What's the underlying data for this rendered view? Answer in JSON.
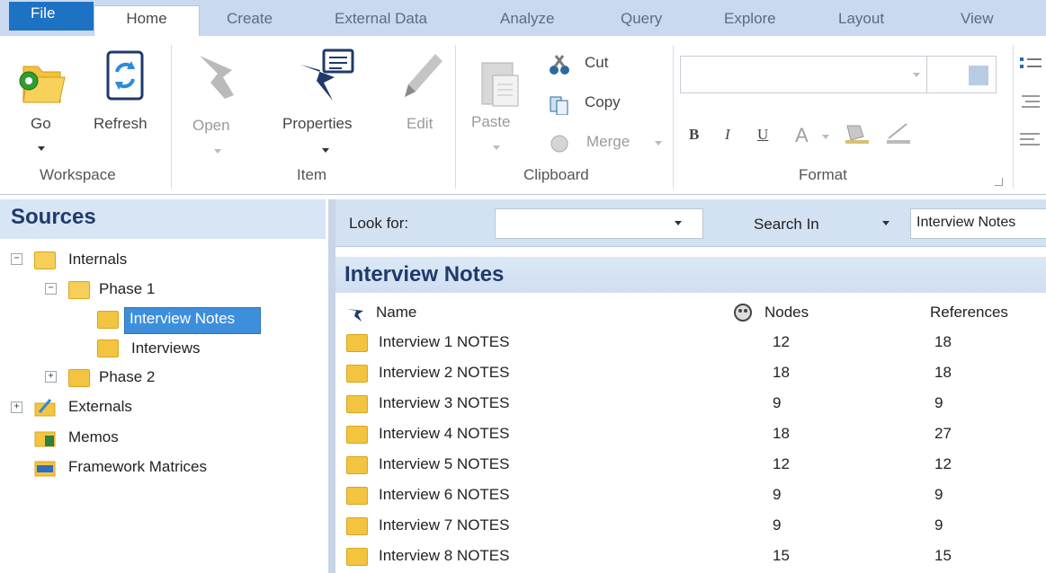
{
  "ribbon": {
    "tabs": [
      "File",
      "Home",
      "Create",
      "External Data",
      "Analyze",
      "Query",
      "Explore",
      "Layout",
      "View"
    ],
    "active_tab": "Home",
    "groups": {
      "workspace": {
        "label": "Workspace",
        "go": "Go",
        "refresh": "Refresh"
      },
      "item": {
        "label": "Item",
        "open": "Open",
        "properties": "Properties",
        "edit": "Edit"
      },
      "clipboard": {
        "label": "Clipboard",
        "paste": "Paste",
        "cut": "Cut",
        "copy": "Copy",
        "merge": "Merge"
      },
      "format": {
        "label": "Format",
        "bold": "B",
        "italic": "I",
        "underline": "U",
        "font_color": "A"
      }
    }
  },
  "sources": {
    "title": "Sources",
    "tree": {
      "internals": "Internals",
      "phase1": "Phase 1",
      "interview_notes": "Interview Notes",
      "interviews": "Interviews",
      "phase2": "Phase 2",
      "externals": "Externals",
      "memos": "Memos",
      "framework_matrices": "Framework Matrices"
    }
  },
  "search": {
    "look_for_label": "Look for:",
    "search_in_label": "Search In",
    "search_in_value": "Interview Notes"
  },
  "list": {
    "title": "Interview Notes",
    "columns": {
      "name": "Name",
      "nodes": "Nodes",
      "references": "References"
    },
    "rows": [
      {
        "name": "Interview 1 NOTES",
        "nodes": "12",
        "references": "18"
      },
      {
        "name": "Interview 2 NOTES",
        "nodes": "18",
        "references": "18"
      },
      {
        "name": "Interview 3 NOTES",
        "nodes": "9",
        "references": "9"
      },
      {
        "name": "Interview 4 NOTES",
        "nodes": "18",
        "references": "27"
      },
      {
        "name": "Interview 5 NOTES",
        "nodes": "12",
        "references": "12"
      },
      {
        "name": "Interview 6 NOTES",
        "nodes": "9",
        "references": "9"
      },
      {
        "name": "Interview 7 NOTES",
        "nodes": "9",
        "references": "9"
      },
      {
        "name": "Interview 8 NOTES",
        "nodes": "15",
        "references": "15"
      }
    ]
  },
  "colors": {
    "accent": "#1e72c4",
    "selection": "#3d8fdc",
    "header_text": "#1f3a6b"
  }
}
